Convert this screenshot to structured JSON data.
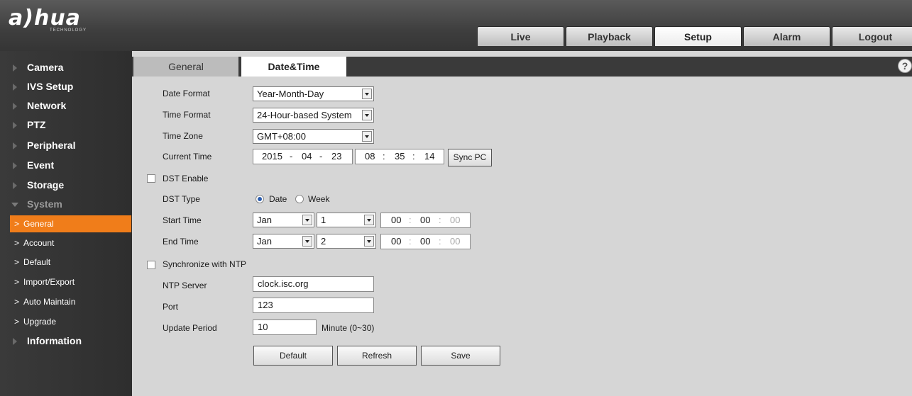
{
  "brand": {
    "logo": "a)hua",
    "logo_sub": "TECHNOLOGY"
  },
  "top_nav": [
    "Live",
    "Playback",
    "Setup",
    "Alarm",
    "Logout"
  ],
  "top_nav_active": "Setup",
  "sidebar": {
    "items": [
      "Camera",
      "IVS Setup",
      "Network",
      "PTZ",
      "Peripheral",
      "Event",
      "Storage",
      "System"
    ],
    "system_sub": [
      "General",
      "Account",
      "Default",
      "Import/Export",
      "Auto Maintain",
      "Upgrade"
    ],
    "after": "Information"
  },
  "tabs": {
    "general": "General",
    "datetime": "Date&Time"
  },
  "help_icon": "?",
  "form": {
    "date_format_label": "Date Format",
    "date_format_value": "Year-Month-Day",
    "time_format_label": "Time Format",
    "time_format_value": "24-Hour-based System",
    "time_zone_label": "Time Zone",
    "time_zone_value": "GMT+08:00",
    "current_time_label": "Current Time",
    "date": {
      "y": "2015",
      "m": "04",
      "d": "23",
      "sep": "-"
    },
    "time": {
      "h": "08",
      "mi": "35",
      "s": "14",
      "sep": ":"
    },
    "sync_pc": "Sync PC",
    "dst_enable": "DST Enable",
    "dst_type_label": "DST Type",
    "dst_date": "Date",
    "dst_week": "Week",
    "start_time_label": "Start Time",
    "start_month": "Jan",
    "start_day": "1",
    "end_time_label": "End Time",
    "end_month": "Jan",
    "end_day": "2",
    "zero": "00",
    "sync_ntp": "Synchronize with NTP",
    "ntp_server_label": "NTP Server",
    "ntp_server_value": "clock.isc.org",
    "port_label": "Port",
    "port_value": "123",
    "update_period_label": "Update Period",
    "update_period_value": "10",
    "minute_hint": "Minute (0~30)",
    "default_btn": "Default",
    "refresh_btn": "Refresh",
    "save_btn": "Save"
  }
}
